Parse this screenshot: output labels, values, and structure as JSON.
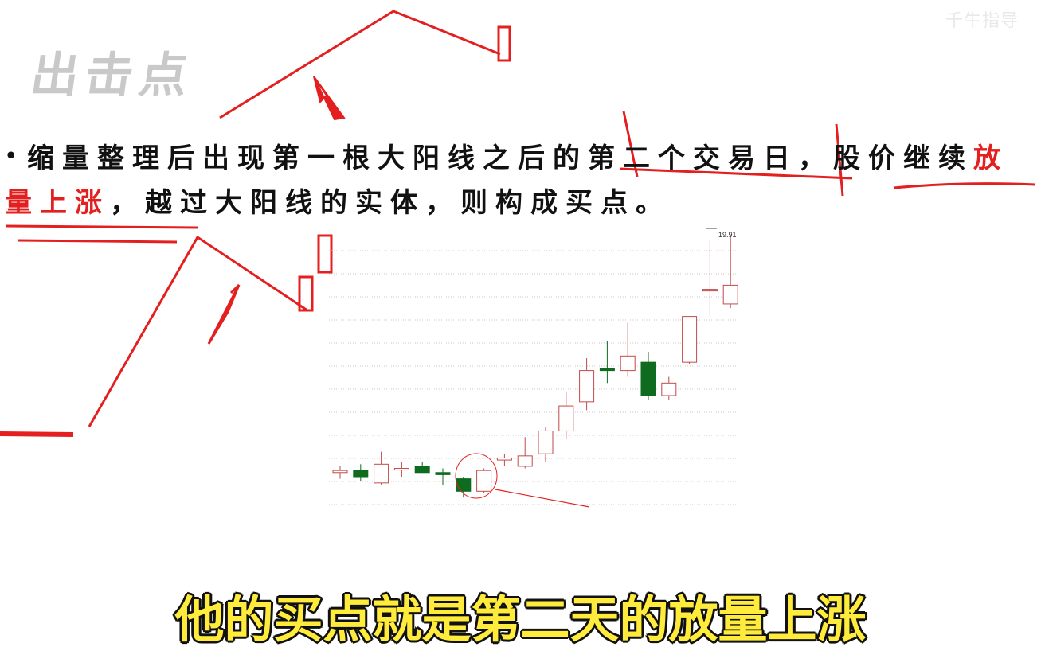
{
  "watermark": "千牛指导",
  "section_title": "出击点",
  "bullet": {
    "part1": "缩量整理后出现第一根大阳线之后的第二个交易日，股价继续",
    "highlight": "放量上涨",
    "part2": "，越过大阳线的实体，则构成买点。"
  },
  "subtitle": "他的买点就是第二天的放量上涨",
  "colors": {
    "annotation_red": "#e41f1f",
    "bullish": "#c24a4a",
    "bearish": "#0e6b1f",
    "subtitle": "#ffeb3b"
  },
  "chart_data": {
    "type": "candlestick",
    "peak_label": "19.91",
    "candles": [
      {
        "o": 14.15,
        "h": 14.3,
        "l": 14.0,
        "c": 14.2
      },
      {
        "o": 14.2,
        "h": 14.35,
        "l": 13.95,
        "c": 14.05
      },
      {
        "o": 13.9,
        "h": 14.65,
        "l": 13.85,
        "c": 14.35
      },
      {
        "o": 14.25,
        "h": 14.4,
        "l": 14.05,
        "c": 14.25
      },
      {
        "o": 14.3,
        "h": 14.4,
        "l": 14.15,
        "c": 14.15
      },
      {
        "o": 14.15,
        "h": 14.25,
        "l": 13.85,
        "c": 14.1
      },
      {
        "o": 14.0,
        "h": 14.05,
        "l": 13.55,
        "c": 13.7
      },
      {
        "o": 13.7,
        "h": 14.25,
        "l": 13.65,
        "c": 14.2
      },
      {
        "o": 14.45,
        "h": 14.6,
        "l": 14.3,
        "c": 14.5
      },
      {
        "o": 14.3,
        "h": 15.0,
        "l": 14.25,
        "c": 14.55
      },
      {
        "o": 14.6,
        "h": 15.25,
        "l": 14.4,
        "c": 15.15
      },
      {
        "o": 15.15,
        "h": 16.1,
        "l": 14.95,
        "c": 15.75
      },
      {
        "o": 15.85,
        "h": 16.9,
        "l": 15.65,
        "c": 16.6
      },
      {
        "o": 16.65,
        "h": 17.3,
        "l": 16.3,
        "c": 16.6
      },
      {
        "o": 16.6,
        "h": 17.75,
        "l": 16.45,
        "c": 16.95
      },
      {
        "o": 16.8,
        "h": 17.05,
        "l": 15.9,
        "c": 16.0
      },
      {
        "o": 16.0,
        "h": 16.45,
        "l": 15.9,
        "c": 16.3
      },
      {
        "o": 16.8,
        "h": 17.9,
        "l": 16.75,
        "c": 17.9
      },
      {
        "o": 18.55,
        "h": 19.75,
        "l": 17.9,
        "c": 18.55
      },
      {
        "o": 18.2,
        "h": 19.85,
        "l": 18.1,
        "c": 18.65
      }
    ]
  }
}
